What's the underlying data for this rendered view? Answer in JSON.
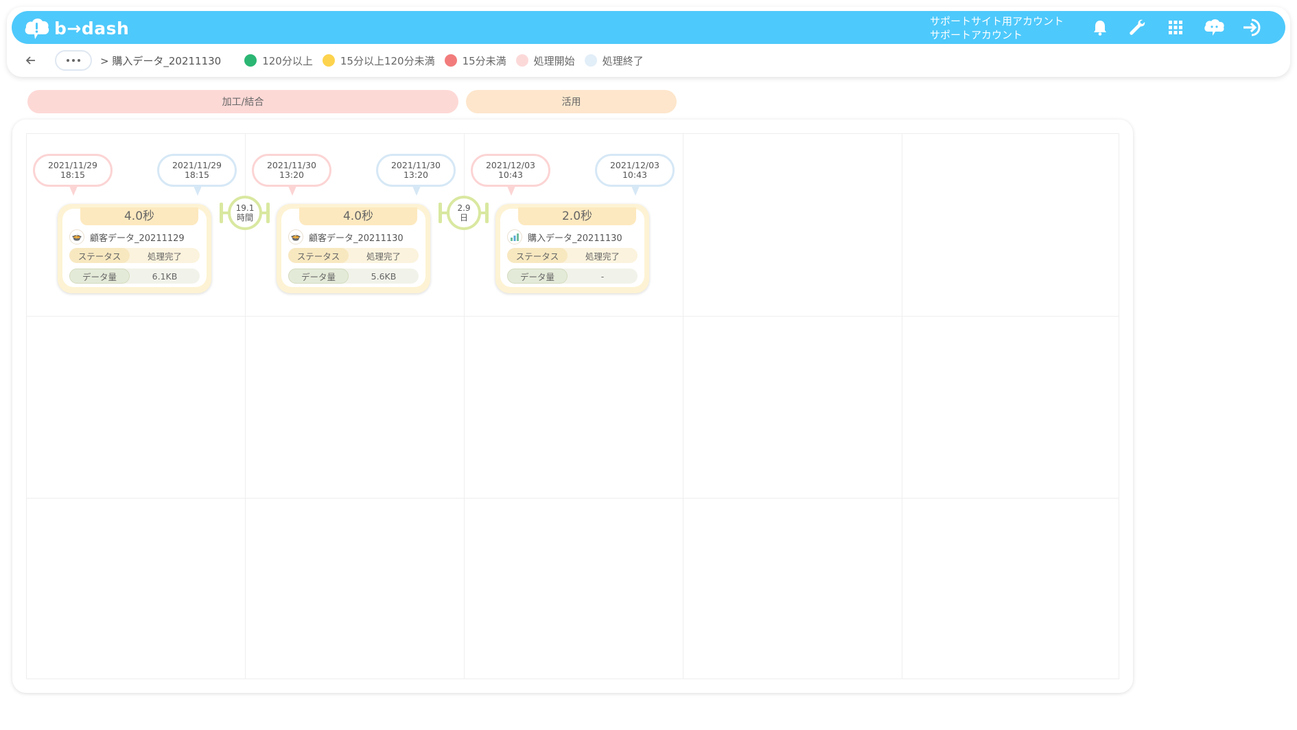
{
  "app": {
    "logo_text": "b→dash",
    "account_line1": "サポートサイト用アカウント",
    "account_line2": "サポートアカウント"
  },
  "header_icons": [
    "bell-icon",
    "wrench-icon",
    "apps-grid-icon",
    "support-chat-icon",
    "logout-icon"
  ],
  "breadcrumb": {
    "separator": ">",
    "current": "購入データ_20211130"
  },
  "legend": [
    {
      "label": "120分以上",
      "color": "#2bb673"
    },
    {
      "label": "15分以上120分未満",
      "color": "#fdd34d"
    },
    {
      "label": "15分未満",
      "color": "#f27c7c"
    },
    {
      "label": "処理開始",
      "color": "#fcd9d9"
    },
    {
      "label": "処理終了",
      "color": "#e2eef8"
    }
  ],
  "phases": [
    {
      "label": "加工/結合",
      "color": "#fdd9d6"
    },
    {
      "label": "活用",
      "color": "#fde6cc"
    }
  ],
  "nodes": [
    {
      "start_date": "2021/11/29",
      "start_time": "18:15",
      "end_date": "2021/11/29",
      "end_time": "18:15",
      "duration": "4.0秒",
      "name": "顧客データ_20211129",
      "status_label": "ステータス",
      "status_value": "処理完了",
      "size_label": "データ量",
      "size_value": "6.1KB",
      "icon": "pot-icon"
    },
    {
      "start_date": "2021/11/30",
      "start_time": "13:20",
      "end_date": "2021/11/30",
      "end_time": "13:20",
      "duration": "4.0秒",
      "name": "顧客データ_20211130",
      "status_label": "ステータス",
      "status_value": "処理完了",
      "size_label": "データ量",
      "size_value": "5.6KB",
      "icon": "pot-icon"
    },
    {
      "start_date": "2021/12/03",
      "start_time": "10:43",
      "end_date": "2021/12/03",
      "end_time": "10:43",
      "duration": "2.0秒",
      "name": "購入データ_20211130",
      "status_label": "ステータス",
      "status_value": "処理完了",
      "size_label": "データ量",
      "size_value": "-",
      "icon": "chart-icon"
    }
  ],
  "connectors": [
    {
      "line1": "19.1",
      "line2": "時間"
    },
    {
      "line1": "2.9",
      "line2": "日"
    }
  ]
}
